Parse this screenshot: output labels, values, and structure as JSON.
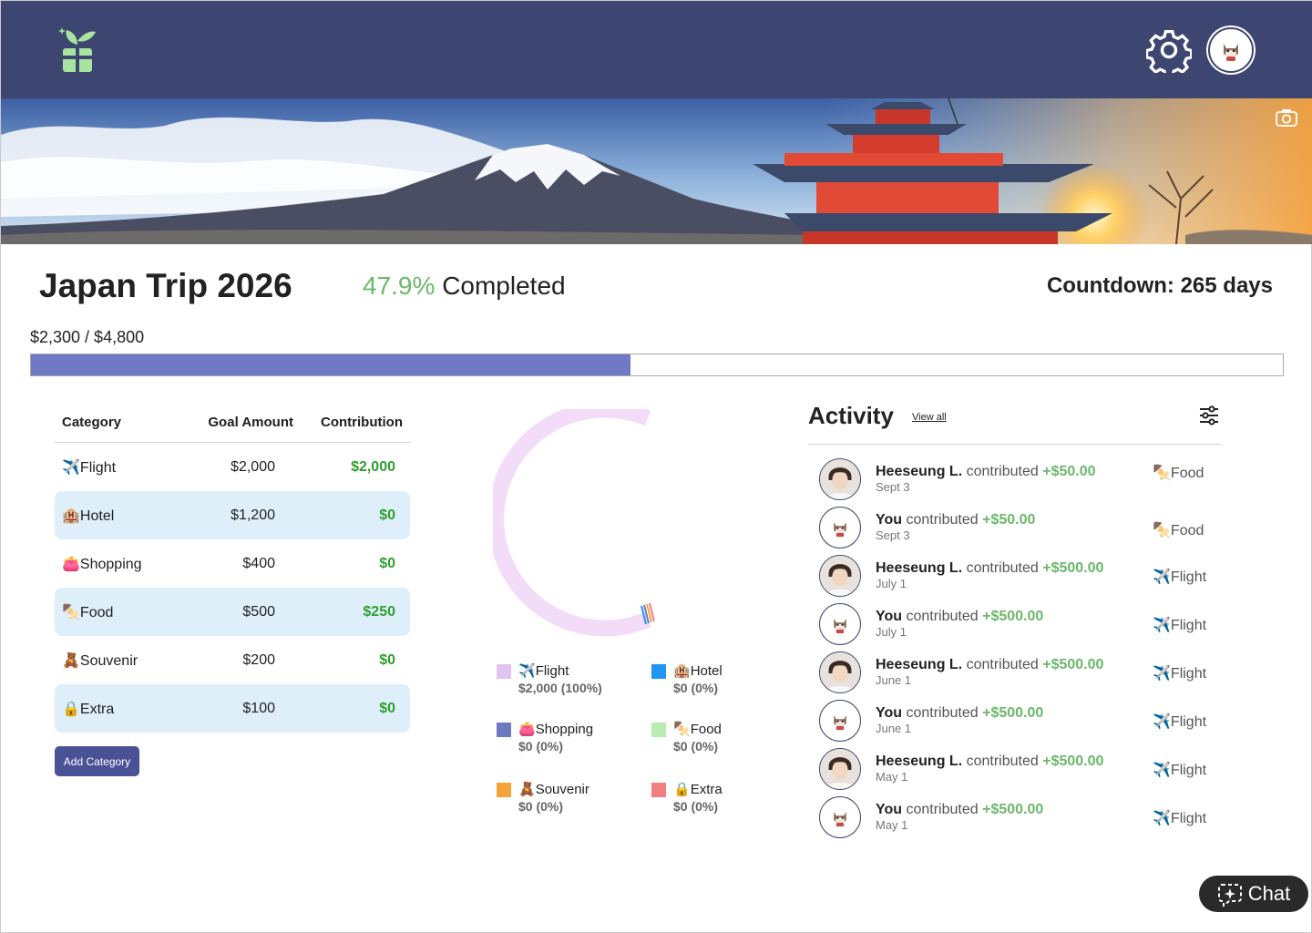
{
  "trip": {
    "title": "Japan Trip 2026",
    "percent": "47.9%",
    "completed_label": "Completed",
    "countdown": "Countdown: 265 days",
    "amounts": "$2,300 / $4,800",
    "progress_fraction": 0.479
  },
  "table": {
    "headers": {
      "category": "Category",
      "goal": "Goal Amount",
      "contribution": "Contribution"
    },
    "rows": [
      {
        "icon": "✈️",
        "category": "Flight",
        "goal": "$2,000",
        "contribution": "$2,000"
      },
      {
        "icon": "🏨",
        "category": "Hotel",
        "goal": "$1,200",
        "contribution": "$0"
      },
      {
        "icon": "👛",
        "category": "Shopping",
        "goal": "$400",
        "contribution": "$0"
      },
      {
        "icon": "🍢",
        "category": "Food",
        "goal": "$500",
        "contribution": "$250"
      },
      {
        "icon": "🧸",
        "category": "Souvenir",
        "goal": "$200",
        "contribution": "$0"
      },
      {
        "icon": "🔒",
        "category": "Extra",
        "goal": "$100",
        "contribution": "$0"
      }
    ],
    "add_button": "Add Category"
  },
  "legend": [
    {
      "icon": "✈️",
      "label": "Flight",
      "value": "$2,000 (100%)",
      "color": "#e2c4f0"
    },
    {
      "icon": "🏨",
      "label": "Hotel",
      "value": "$0 (0%)",
      "color": "#2196f3"
    },
    {
      "icon": "👛",
      "label": "Shopping",
      "value": "$0 (0%)",
      "color": "#6f79c2"
    },
    {
      "icon": "🍢",
      "label": "Food",
      "value": "$0 (0%)",
      "color": "#b8ecb0"
    },
    {
      "icon": "🧸",
      "label": "Souvenir",
      "value": "$0 (0%)",
      "color": "#f5a43a"
    },
    {
      "icon": "🔒",
      "label": "Extra",
      "value": "$0 (0%)",
      "color": "#f27f7f"
    }
  ],
  "activity": {
    "title": "Activity",
    "view_all": "View all",
    "items": [
      {
        "name": "Heeseung L.",
        "verb": "contributed",
        "amount": "+$50.00",
        "date": "Sept 3",
        "category_icon": "🍢",
        "category": "Food",
        "avatar": "person"
      },
      {
        "name": "You",
        "verb": "contributed",
        "amount": "+$50.00",
        "date": "Sept 3",
        "category_icon": "🍢",
        "category": "Food",
        "avatar": "cat"
      },
      {
        "name": "Heeseung L.",
        "verb": "contributed",
        "amount": "+$500.00",
        "date": "July 1",
        "category_icon": "✈️",
        "category": "Flight",
        "avatar": "person"
      },
      {
        "name": "You",
        "verb": "contributed",
        "amount": "+$500.00",
        "date": "July 1",
        "category_icon": "✈️",
        "category": "Flight",
        "avatar": "cat"
      },
      {
        "name": "Heeseung L.",
        "verb": "contributed",
        "amount": "+$500.00",
        "date": "June 1",
        "category_icon": "✈️",
        "category": "Flight",
        "avatar": "person"
      },
      {
        "name": "You",
        "verb": "contributed",
        "amount": "+$500.00",
        "date": "June 1",
        "category_icon": "✈️",
        "category": "Flight",
        "avatar": "cat"
      },
      {
        "name": "Heeseung L.",
        "verb": "contributed",
        "amount": "+$500.00",
        "date": "May 1",
        "category_icon": "✈️",
        "category": "Flight",
        "avatar": "person"
      },
      {
        "name": "You",
        "verb": "contributed",
        "amount": "+$500.00",
        "date": "May 1",
        "category_icon": "✈️",
        "category": "Flight",
        "avatar": "cat"
      }
    ]
  },
  "chat": {
    "label": "Chat"
  },
  "colors": {
    "navbar": "#3d4670",
    "accent_green": "#6bb86b",
    "progress": "#7079c3",
    "button": "#4a5296"
  }
}
